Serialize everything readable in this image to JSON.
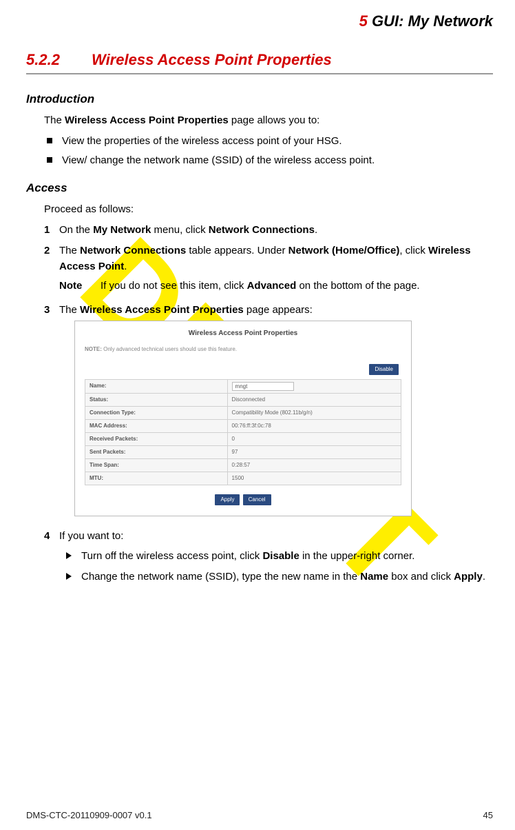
{
  "watermark": "DRAFT",
  "chapter": {
    "num": "5",
    "title": "GUI: My Network"
  },
  "section": {
    "num": "5.2.2",
    "title": "Wireless Access Point Properties"
  },
  "intro": {
    "heading": "Introduction",
    "lead_pre": "The ",
    "lead_bold": "Wireless Access Point Properties",
    "lead_post": " page allows you to:",
    "bullets": [
      "View the properties of the wireless access point of your HSG.",
      "View/ change the network name (SSID) of the wireless access point."
    ]
  },
  "access": {
    "heading": "Access",
    "lead": "Proceed as follows:",
    "steps": {
      "s1": {
        "num": "1",
        "t1": "On the ",
        "b1": "My Network",
        "t2": " menu, click ",
        "b2": "Network Connections",
        "t3": "."
      },
      "s2": {
        "num": "2",
        "t1": "The ",
        "b1": "Network Connections",
        "t2": " table appears. Under ",
        "b2": "Network (Home/Office)",
        "t3": ", click ",
        "b3": "Wireless Access Point",
        "t4": ".",
        "note_label": "Note",
        "note_t1": "If you do not see this item, click ",
        "note_b1": "Advanced",
        "note_t2": " on the bottom of the page."
      },
      "s3": {
        "num": "3",
        "t1": "The ",
        "b1": "Wireless Access Point Properties",
        "t2": " page appears:"
      },
      "s4": {
        "num": "4",
        "lead": "If you want to:",
        "a_t1": "Turn off the wireless access point, click ",
        "a_b1": "Disable",
        "a_t2": " in the upper-right corner.",
        "b_t1": "Change the network name (SSID), type the new name in the ",
        "b_b1": "Name",
        "b_t2": " box and click ",
        "b_b2": "Apply",
        "b_t3": "."
      }
    }
  },
  "shot": {
    "title": "Wireless Access Point Properties",
    "note_prefix": "NOTE:",
    "note_text": " Only advanced technical users should use this feature.",
    "disable_btn": "Disable",
    "rows": {
      "name_label": "Name:",
      "name_value": "mngt",
      "status_label": "Status:",
      "status_value": "Disconnected",
      "conn_label": "Connection Type:",
      "conn_value": "Compatibility Mode (802.11b/g/n)",
      "mac_label": "MAC Address:",
      "mac_value": "00:76:ff:3f:0c:78",
      "recv_label": "Received Packets:",
      "recv_value": "0",
      "sent_label": "Sent Packets:",
      "sent_value": "97",
      "time_label": "Time Span:",
      "time_value": "0:28:57",
      "mtu_label": "MTU:",
      "mtu_value": "1500"
    },
    "apply_btn": "Apply",
    "cancel_btn": "Cancel"
  },
  "footer": {
    "doc_id": "DMS-CTC-20110909-0007 v0.1",
    "page": "45"
  }
}
